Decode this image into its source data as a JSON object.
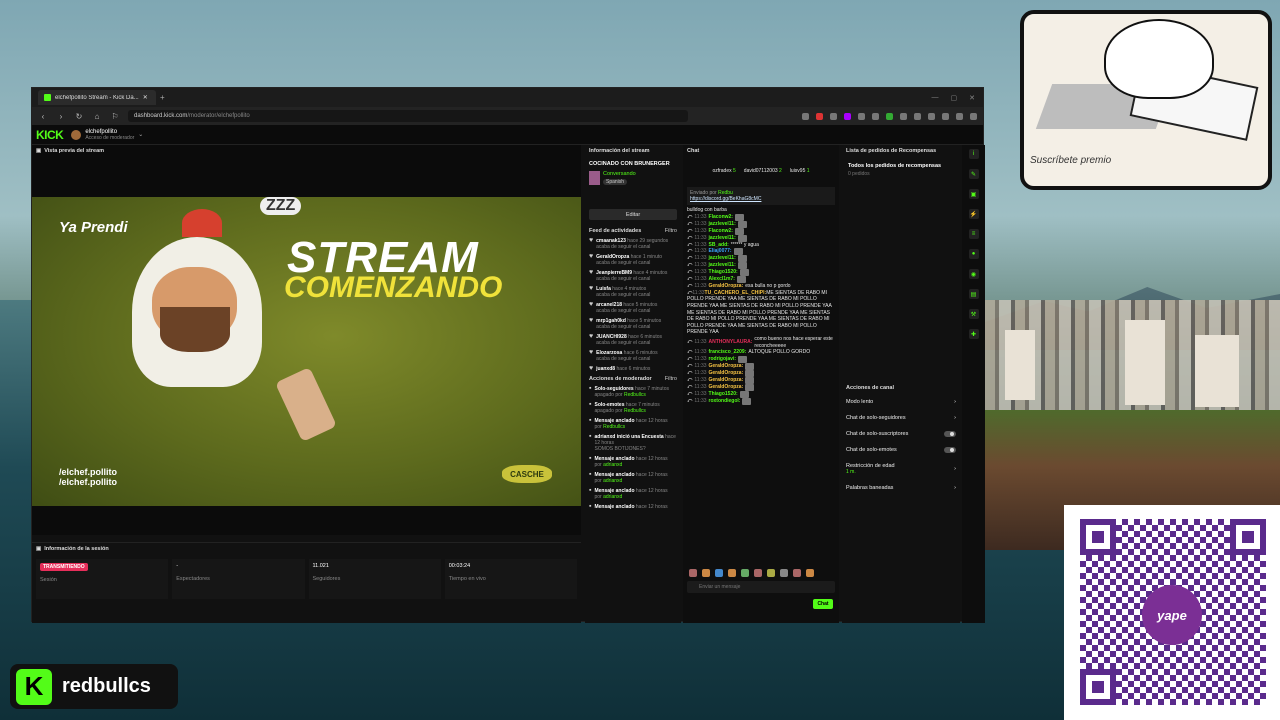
{
  "browser": {
    "tab_title": "elchefpollito Stream - Kick Da...",
    "url_host": "dashboard.kick.com",
    "url_path": "/moderator/elchefpollito"
  },
  "kick": {
    "logo": "KICK",
    "channel_name": "elchefpollito",
    "channel_role": "Acceso de moderador"
  },
  "preview": {
    "title": "Vista previa del stream",
    "video": {
      "ya_prendi": "Ya Prendi",
      "zzz": "ZZZ",
      "stream": "STREAM",
      "comenzando": "COMENZANDO",
      "social1": "/elchef.pollito",
      "social2": "/elchef.pollito",
      "sponsor": "CASCHE"
    }
  },
  "session": {
    "title": "Información de la sesión",
    "cells": [
      {
        "value": "TRANSMITIENDO",
        "label": "Sesión"
      },
      {
        "value": "-",
        "label": "Espectadores"
      },
      {
        "value": "11.021",
        "label": "Seguidores"
      },
      {
        "value": "00:03:24",
        "label": "Tiempo en vivo"
      }
    ]
  },
  "info": {
    "title": "Información del stream",
    "stream_title": "COCINADO CON BRUNERGER",
    "category": "Conversando",
    "tag": "Spanish",
    "edit_label": "Editar",
    "feed_title": "Feed de actividades",
    "filter_label": "Filtro",
    "feed": [
      {
        "name": "cmaanak123",
        "time": "hace 29 segundos",
        "sub": "acaba de seguir el canal"
      },
      {
        "name": "GeraldOropza",
        "time": "hace 1 minuto",
        "sub": "acaba de seguir el canal"
      },
      {
        "name": "JeanpierreBM9",
        "time": "hace 4 minutos",
        "sub": "acaba de seguir el canal"
      },
      {
        "name": "Luisfa",
        "time": "hace 4 minutos",
        "sub": "acaba de seguir el canal"
      },
      {
        "name": "arcanel218",
        "time": "hace 5 minutos",
        "sub": "acaba de seguir el canal"
      },
      {
        "name": "mrp1gah0kd",
        "time": "hace 5 minutos",
        "sub": "acaba de seguir el canal"
      },
      {
        "name": "JUANCHI928",
        "time": "hace 6 minutos",
        "sub": "acaba de seguir el canal"
      },
      {
        "name": "Elozarzosa",
        "time": "hace 6 minutos",
        "sub": "acaba de seguir el canal"
      },
      {
        "name": "juanxd8",
        "time": "hace 6 minutos",
        "sub": ""
      }
    ],
    "mod_title": "Acciones de moderador",
    "mod": [
      {
        "name": "Solo-seguidores",
        "time": "hace 7 minutos",
        "sub": "apagado por",
        "by": "Redbullcs"
      },
      {
        "name": "Solo-emotes",
        "time": "hace 7 minutos",
        "sub": "apagado por",
        "by": "Redbullcs"
      },
      {
        "name": "Mensaje anclado",
        "time": "hace 12 horas",
        "sub": "por",
        "by": "Redbullcs"
      },
      {
        "name": "adrianxd inició una Encuesta",
        "time": "hace 12 horas",
        "sub": "SOMOS BOTIJONES?",
        "by": ""
      },
      {
        "name": "Mensaje anclado",
        "time": "hace 12 horas",
        "sub": "por",
        "by": "adrianxd"
      },
      {
        "name": "Mensaje anclado",
        "time": "hace 12 horas",
        "sub": "por",
        "by": "adrianxd"
      },
      {
        "name": "Mensaje anclado",
        "time": "hace 12 horas",
        "sub": "por",
        "by": "adrianxd"
      },
      {
        "name": "Mensaje anclado",
        "time": "hace 12 horas",
        "sub": "",
        "by": ""
      }
    ]
  },
  "chat": {
    "title": "Chat",
    "top_users": [
      {
        "name": "ozfradex",
        "count": "5"
      },
      {
        "name": "david07112003",
        "count": "2"
      },
      {
        "name": "luisv95",
        "count": "1"
      }
    ],
    "pinned_by": "Enviado por",
    "pinned_user": "Redbu",
    "pinned_link": "https://discord.gg/BeKhaG8cMC",
    "messages": [
      {
        "time": "",
        "user": "",
        "color": "#ffffff",
        "text": "bulldog con barba"
      },
      {
        "time": "11:33",
        "user": "Flaconw2:",
        "color": "#53fc18",
        "text": ""
      },
      {
        "time": "11:33",
        "user": "jazzlevel11:",
        "color": "#53fc18",
        "text": ""
      },
      {
        "time": "11:33",
        "user": "Flaconw2:",
        "color": "#53fc18",
        "text": ""
      },
      {
        "time": "11:33",
        "user": "jazzlevel11:",
        "color": "#53fc18",
        "text": ""
      },
      {
        "time": "11:33",
        "user": "SB_add:",
        "color": "#53fc18",
        "text": "****** y agua"
      },
      {
        "time": "11:33",
        "user": "Eliaj0077:",
        "color": "#3aa7ff",
        "text": ""
      },
      {
        "time": "11:33",
        "user": "jazzlevel11:",
        "color": "#53fc18",
        "text": ""
      },
      {
        "time": "11:33",
        "user": "jazzlevel11:",
        "color": "#53fc18",
        "text": ""
      },
      {
        "time": "11:33",
        "user": "Thiago1520:",
        "color": "#53fc18",
        "text": ""
      },
      {
        "time": "11:33",
        "user": "Alexcl1m7:",
        "color": "#53fc18",
        "text": ""
      },
      {
        "time": "11:33",
        "user": "GeraldOropza:",
        "color": "#f6c343",
        "text": "esa bulla no p gordo"
      },
      {
        "time": "11:33",
        "user": "TU_CACHERO_EL_CHIPI:",
        "color": "#f6c343",
        "text": "ME SIENTAS DE RABO MI POLLO PRENDE YAA ME SIENTAS DE RABO MI POLLO PRENDE YAA ME SIENTAS DE RABO MI POLLO PRENDE YAA ME SIENTAS DE RABO MI POLLO PRENDE YAA ME SIENTAS DE RABO MI POLLO PRENDE YAA ME SIENTAS DE RABO MI POLLO PRENDE YAA ME SIENTAS DE RABO MI POLLO PRENDE YAA"
      },
      {
        "time": "11:33",
        "user": "ANTHONYLAURA:",
        "color": "#e62e5a",
        "text": "como bueno nos hace esperar este reconcheeeee"
      },
      {
        "time": "11:33",
        "user": "francisco_2209:",
        "color": "#53fc18",
        "text": "ALTOQUE POLLO GORDO"
      },
      {
        "time": "11:33",
        "user": "rodrigojavi:",
        "color": "#53fc18",
        "text": ""
      },
      {
        "time": "11:33",
        "user": "GeraldOropza:",
        "color": "#f6c343",
        "text": ""
      },
      {
        "time": "11:33",
        "user": "GeraldOropza:",
        "color": "#f6c343",
        "text": ""
      },
      {
        "time": "11:33",
        "user": "GeraldOropza:",
        "color": "#f6c343",
        "text": ""
      },
      {
        "time": "11:33",
        "user": "GeraldOropza:",
        "color": "#f6c343",
        "text": ""
      },
      {
        "time": "11:33",
        "user": "Thiago1520:",
        "color": "#53fc18",
        "text": ""
      },
      {
        "time": "11:33",
        "user": "roxtondiegol:",
        "color": "#53fc18",
        "text": ""
      }
    ],
    "input_placeholder": "Enviar un mensaje",
    "send_label": "Chat"
  },
  "rewards": {
    "title": "Lista de pedidos de Recompensas",
    "all": "Todos los pedidos de recompensas",
    "count": "0 pedidos"
  },
  "actions": {
    "title": "Acciones de canal",
    "items": [
      {
        "label": "Modo lento",
        "kind": "arrow"
      },
      {
        "label": "Chat de solo-seguidores",
        "kind": "arrow"
      },
      {
        "label": "Chat de solo-suscriptores",
        "kind": "toggle"
      },
      {
        "label": "Chat de solo-emotes",
        "kind": "toggle"
      },
      {
        "label": "Restricción de edad",
        "sub": "1 m.",
        "kind": "arrow"
      },
      {
        "label": "Palabras baneadas",
        "kind": "arrow"
      }
    ]
  },
  "overlay": {
    "cat_caption": "Suscríbete premio",
    "yape": "yape",
    "brand_k": "K",
    "brand_name": "redbullcs"
  }
}
